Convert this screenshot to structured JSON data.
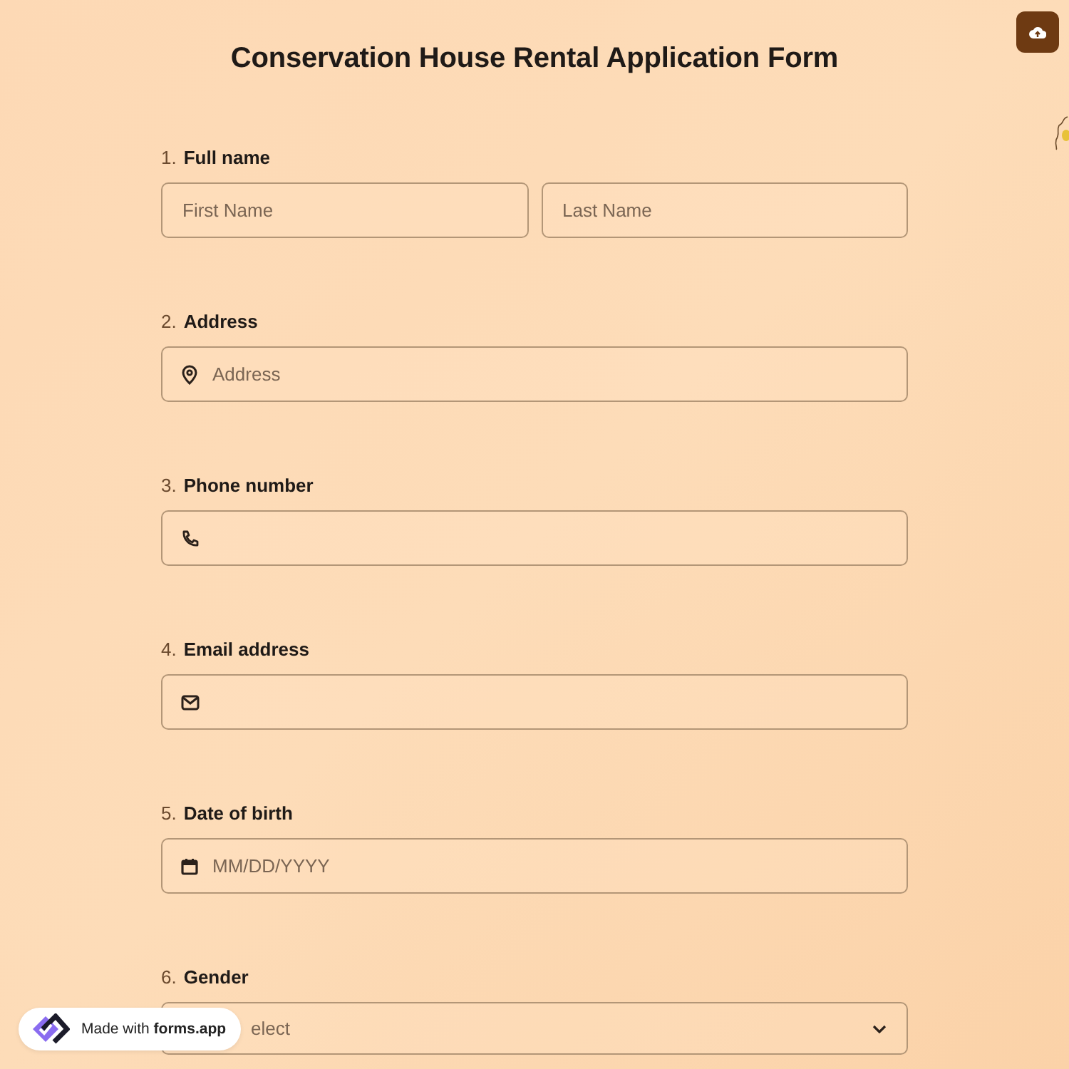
{
  "title": "Conservation House Rental Application Form",
  "questions": [
    {
      "number": "1.",
      "label": "Full name",
      "kind": "name",
      "inputs": [
        {
          "placeholder": "First Name"
        },
        {
          "placeholder": "Last Name"
        }
      ]
    },
    {
      "number": "2.",
      "label": "Address",
      "kind": "address",
      "placeholder": "Address"
    },
    {
      "number": "3.",
      "label": "Phone number",
      "kind": "phone"
    },
    {
      "number": "4.",
      "label": "Email address",
      "kind": "email"
    },
    {
      "number": "5.",
      "label": "Date of birth",
      "kind": "date",
      "placeholder": "MM/DD/YYYY"
    },
    {
      "number": "6.",
      "label": "Gender",
      "kind": "select",
      "placeholder": "elect"
    }
  ],
  "badge": {
    "text": "Made with **forms.app**"
  }
}
